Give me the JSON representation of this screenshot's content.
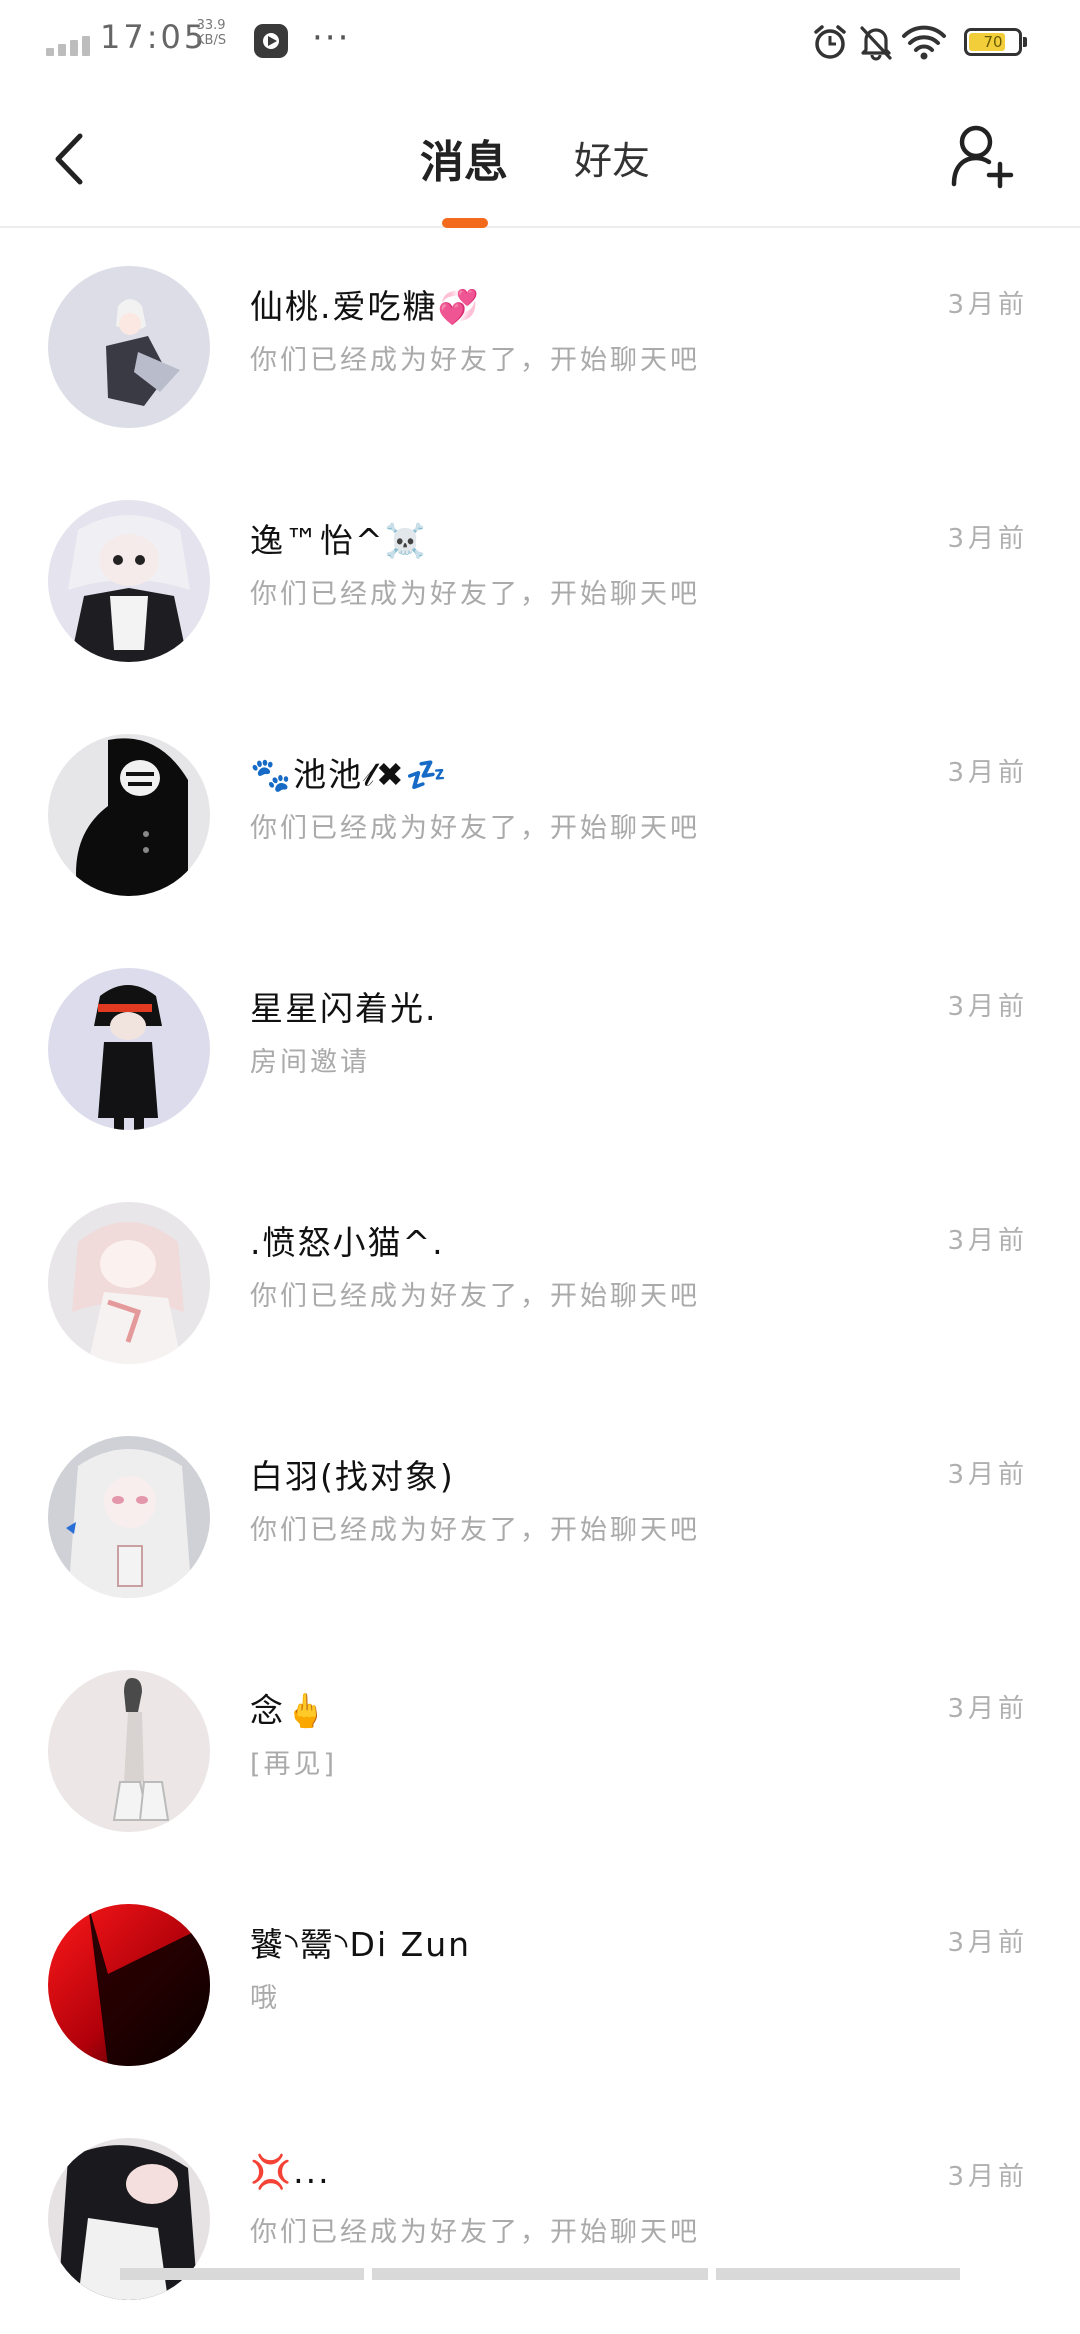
{
  "status_bar": {
    "time": "17:05",
    "net_speed_value": "33.9",
    "net_speed_unit": "KB/S",
    "more": "···",
    "battery_level": 70
  },
  "header": {
    "tab_messages": "消息",
    "tab_friends": "好友"
  },
  "conversations": [
    {
      "name": "仙桃.爱吃糖💞",
      "preview": "你们已经成为好友了，开始聊天吧",
      "time": "3月前"
    },
    {
      "name": "逸™怡^☠️",
      "preview": "你们已经成为好友了，开始聊天吧",
      "time": "3月前"
    },
    {
      "name": "🐾池池𝓁✖💤",
      "preview": "你们已经成为好友了，开始聊天吧",
      "time": "3月前"
    },
    {
      "name": "星星闪着光.",
      "preview": "房间邀请",
      "time": "3月前"
    },
    {
      "name": ".愤怒小猫^.",
      "preview": "你们已经成为好友了，开始聊天吧",
      "time": "3月前"
    },
    {
      "name": "白羽(找对象)",
      "preview": "你们已经成为好友了，开始聊天吧",
      "time": "3月前"
    },
    {
      "name": "念🖕",
      "preview": "[再见]",
      "time": "3月前"
    },
    {
      "name": "饕◝鬵◝Di Zun",
      "preview": "哦",
      "time": "3月前"
    },
    {
      "name": "💢...",
      "preview": "你们已经成为好友了，开始聊天吧",
      "time": "3月前"
    }
  ],
  "colors": {
    "accent": "#f36a1c",
    "name_text": "#111111",
    "preview_text": "#aaaaaa",
    "time_text": "#b0b0b0",
    "battery_fill": "#f2cf3a"
  },
  "icons": [
    "back-arrow-icon",
    "add-friend-icon",
    "alarm-icon",
    "mute-bell-icon",
    "wifi-icon",
    "battery-icon",
    "play-icon"
  ]
}
